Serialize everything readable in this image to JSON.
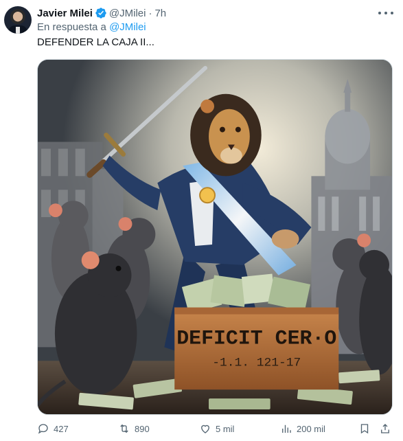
{
  "tweet": {
    "author_name": "Javier Milei",
    "handle": "@JMilei",
    "separator": "·",
    "time": "7h",
    "reply_prefix": "En respuesta a",
    "reply_to": "@JMilei",
    "text": "DEFENDER LA CAJA II...",
    "image": {
      "box_label_main": "DEFICIT CER·O",
      "box_label_sub": "-1.1. 121-17"
    }
  },
  "actions": {
    "replies": "427",
    "retweets": "890",
    "likes": "5 mil",
    "views": "200 mil"
  },
  "colors": {
    "text_primary": "#0f1419",
    "text_secondary": "#536471",
    "accent": "#1d9bf0"
  }
}
